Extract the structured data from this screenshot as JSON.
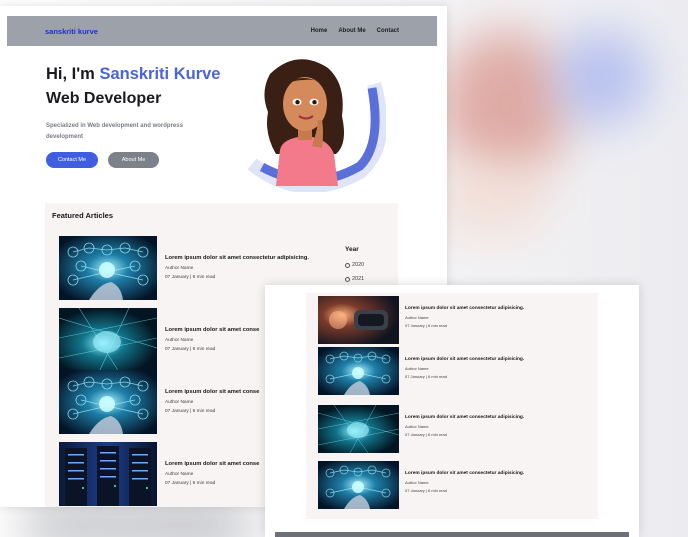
{
  "nav": {
    "brand": "sanskriti kurve",
    "links": [
      "Home",
      "About Me",
      "Contact"
    ]
  },
  "hero": {
    "greeting": "Hi, I'm ",
    "name": "Sanskriti Kurve",
    "role": "Web Developer",
    "description": "Specialized in Web development and wordpress development",
    "contact_button": "Contact Me",
    "about_button": "About Me"
  },
  "articles": {
    "heading": "Featured Articles",
    "items": [
      {
        "title": "Lorem ipsum dolor sit amet consectetur adipisicing.",
        "author": "Author Name",
        "meta": "07 January | 6 min read",
        "image": "ai-network-hand"
      },
      {
        "title": "Lorem ipsum dolor sit amet conse",
        "author": "Author Name",
        "meta": "07 January | 6 min read",
        "image": "digital-brain"
      },
      {
        "title": "Lorem ipsum dolor sit amet conse",
        "author": "Author Name",
        "meta": "07 January | 6 min read",
        "image": "ai-network-hand"
      },
      {
        "title": "Lorem ipsum dolor sit amet conse",
        "author": "Author Name",
        "meta": "07 January | 6 min read",
        "image": "server-racks"
      }
    ]
  },
  "year_filter": {
    "heading": "Year",
    "options": [
      "2020",
      "2021"
    ]
  },
  "second_page": {
    "items": [
      {
        "title": "Lorem ipsum dolor sit amet consectetur adipisicing.",
        "author": "Author Name",
        "meta": "07 January | 6 min read",
        "image": "vr-robot"
      },
      {
        "title": "Lorem ipsum dolor sit amet consectetur adipisicing.",
        "author": "Author Name",
        "meta": "07 January | 6 min read",
        "image": "ai-network-hand"
      },
      {
        "title": "Lorem ipsum dolor sit amet consectetur adipisicing.",
        "author": "Author Name",
        "meta": "07 January | 6 min read",
        "image": "digital-brain"
      },
      {
        "title": "Lorem ipsum dolor sit amet consectetur adipisicing.",
        "author": "Author Name",
        "meta": "07 January | 6 min read",
        "image": "ai-network-hand"
      }
    ]
  },
  "colors": {
    "accent": "#4b64d8",
    "brand": "#1a2fcf",
    "button_primary": "#3f5ee0",
    "button_secondary": "#7d818a",
    "navbar": "#9da2aa",
    "panel": "#f8f4f3"
  }
}
